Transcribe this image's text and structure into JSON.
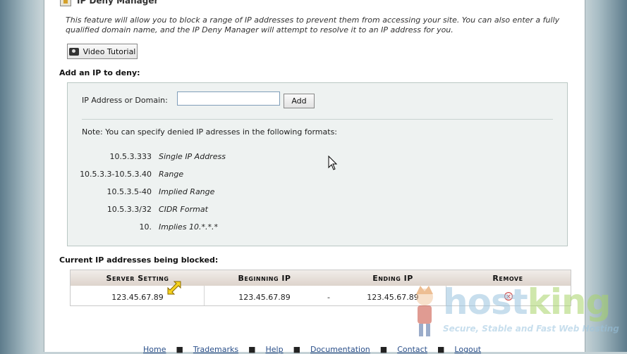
{
  "header": {
    "title": "IP Deny Manager"
  },
  "intro_text": "This feature will allow you to block a range of IP addresses to prevent them from accessing your site. You can also enter a fully qualified domain name, and the IP Deny Manager will attempt to resolve it to an IP address for you.",
  "tutorial_button": "Video Tutorial",
  "add_section": {
    "heading": "Add an IP to deny:",
    "label": "IP Address or Domain:",
    "input_value": "",
    "add_button": "Add",
    "note": "Note: You can specify denied IP adresses in the following formats:",
    "formats": [
      {
        "ip": "10.5.3.333",
        "desc": "Single IP Address"
      },
      {
        "ip": "10.5.3.3-10.5.3.40",
        "desc": "Range"
      },
      {
        "ip": "10.5.3.5-40",
        "desc": "Implied Range"
      },
      {
        "ip": "10.5.3.3/32",
        "desc": "CIDR Format"
      },
      {
        "ip": "10.",
        "desc": "Implies 10.*.*.*"
      }
    ]
  },
  "blocked_section": {
    "heading": "Current IP addresses being blocked:",
    "columns": [
      "Server Setting",
      "Beginning IP",
      "Ending IP",
      "Remove"
    ],
    "rows": [
      {
        "server_setting": "123.45.67.89",
        "beginning_ip": "123.45.67.89",
        "dash": "-",
        "ending_ip": "123.45.67.89"
      }
    ]
  },
  "footer": {
    "links": [
      "Home",
      "Trademarks",
      "Help",
      "Documentation",
      "Contact",
      "Logout"
    ]
  },
  "watermark": {
    "logo_host": "host",
    "logo_king": "king",
    "tagline": "Secure, Stable and Fast Web Hosting"
  },
  "colors": {
    "panel_bg": "#eef2f1",
    "link": "#2a4f8a",
    "header_grad_end": "#ddd3cc",
    "side_bg": "#5e7c8c"
  },
  "icons": [
    "file-lock-icon",
    "camera-icon",
    "remove-icon",
    "mouse-pointer-icon",
    "resize-cursor-icon"
  ]
}
